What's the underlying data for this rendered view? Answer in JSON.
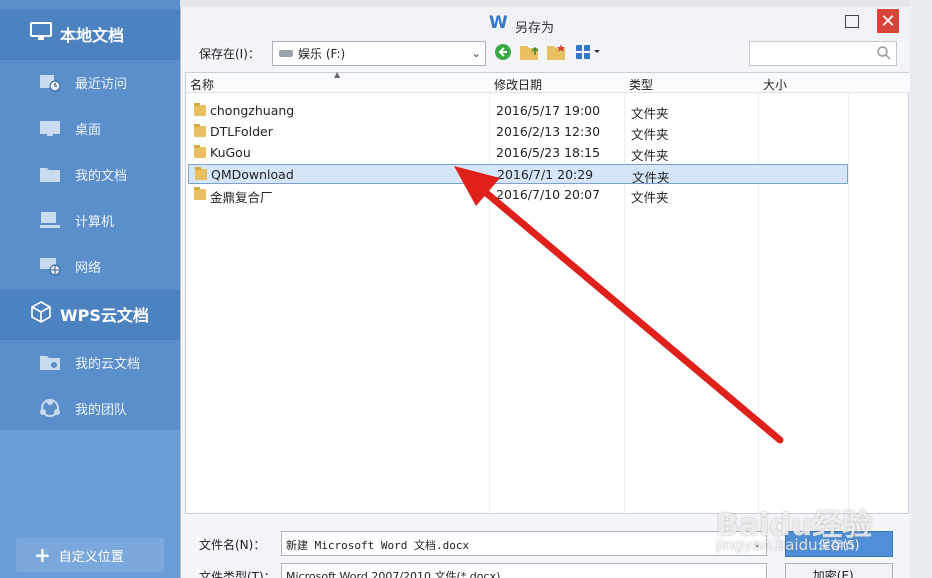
{
  "left_panel": {
    "local_docs_title": "本地文档",
    "items": [
      {
        "label": "最近访问",
        "icon": "recent-icon"
      },
      {
        "label": "桌面",
        "icon": "desktop-icon"
      },
      {
        "label": "我的文档",
        "icon": "my-docs-icon"
      },
      {
        "label": "计算机",
        "icon": "computer-icon"
      },
      {
        "label": "网络",
        "icon": "network-icon"
      }
    ],
    "cloud_title": "WPS云文档",
    "cloud_items": [
      {
        "label": "我的云文档",
        "icon": "cloud-folder-icon"
      },
      {
        "label": "我的团队",
        "icon": "team-icon"
      }
    ],
    "custom_location_label": "自定义位置"
  },
  "dialog": {
    "title": "另存为",
    "logo_letter": "W",
    "save_in_label": "保存在(I)：",
    "location": "娱乐 (F:)",
    "close_glyph": "✕",
    "columns": {
      "name": "名称",
      "modified": "修改日期",
      "type": "类型",
      "size": "大小"
    },
    "files": [
      {
        "name": "chongzhuang",
        "modified": "2016/5/17 19:00",
        "type": "文件夹",
        "selected": false
      },
      {
        "name": "DTLFolder",
        "modified": "2016/2/13 12:30",
        "type": "文件夹",
        "selected": false
      },
      {
        "name": "KuGou",
        "modified": "2016/5/23 18:15",
        "type": "文件夹",
        "selected": false
      },
      {
        "name": "QMDownload",
        "modified": "2016/7/1 20:29",
        "type": "文件夹",
        "selected": true
      },
      {
        "name": "金鼎复合厂",
        "modified": "2016/7/10 20:07",
        "type": "文件夹",
        "selected": false
      }
    ],
    "filename_label": "文件名(N)：",
    "filename_value": "新建 Microsoft Word 文档.docx",
    "filetype_label": "文件类型(T)：",
    "filetype_value": "Microsoft Word 2007/2010 文件(*.docx)",
    "save_button": "保存(S)",
    "encrypt_button": "加密(E)..."
  },
  "watermark": {
    "main": "Baidu经验",
    "sub": "jingyan.baidu.com"
  },
  "colors": {
    "panel": "#5a8fcc",
    "arrow": "#e0201b",
    "selection": "#d5e6fb"
  }
}
